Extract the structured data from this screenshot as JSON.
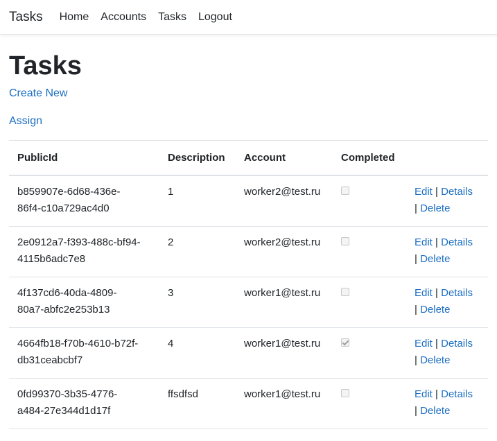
{
  "navbar": {
    "brand": "Tasks",
    "links": [
      "Home",
      "Accounts",
      "Tasks",
      "Logout"
    ]
  },
  "page": {
    "title": "Tasks",
    "create_link": "Create New",
    "assign_link": "Assign"
  },
  "table": {
    "headers": [
      "PublicId",
      "Description",
      "Account",
      "Completed"
    ],
    "rows": [
      {
        "public_id_1": "b859907e-6d68-436e-",
        "public_id_2": "86f4-c10a729ac4d0",
        "description": "1",
        "account": "worker2@test.ru",
        "completed": false
      },
      {
        "public_id_1": "2e0912a7-f393-488c-bf94-",
        "public_id_2": "4115b6adc7e8",
        "description": "2",
        "account": "worker2@test.ru",
        "completed": false
      },
      {
        "public_id_1": "4f137cd6-40da-4809-",
        "public_id_2": "80a7-abfc2e253b13",
        "description": "3",
        "account": "worker1@test.ru",
        "completed": false
      },
      {
        "public_id_1": "4664fb18-f70b-4610-b72f-",
        "public_id_2": "db31ceabcbf7",
        "description": "4",
        "account": "worker1@test.ru",
        "completed": true
      },
      {
        "public_id_1": "0fd99370-3b35-4776-",
        "public_id_2": "a484-27e344d1d17f",
        "description": "ffsdfsd",
        "account": "worker1@test.ru",
        "completed": false
      }
    ],
    "actions": {
      "edit": "Edit",
      "details": "Details",
      "delete": "Delete",
      "separator": "|"
    }
  },
  "colors": {
    "link": "#1b6ec2",
    "text": "#212529",
    "border": "#dee2e6"
  }
}
